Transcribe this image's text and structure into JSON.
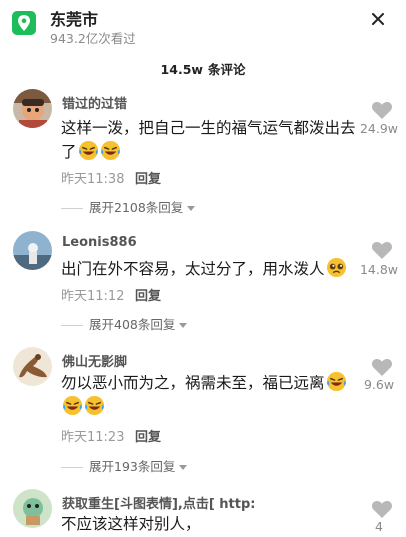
{
  "header": {
    "location_name": "东莞市",
    "views": "943.2亿次看过",
    "location_icon": "location-pin-icon",
    "close_icon": "close-icon"
  },
  "comment_count": {
    "number": "14.5w",
    "label": "条评论"
  },
  "comments": [
    {
      "username": "错过的过错",
      "text": "这样一泼，把自己一生的福气运气都泼出去了",
      "emoji": [
        "laughing-crying-emoji",
        "laughing-crying-emoji"
      ],
      "time": "昨天11:38",
      "reply": "回复",
      "expand": "展开2108条回复",
      "likes": "24.9w"
    },
    {
      "username": "Leonis886",
      "text": "出门在外不容易，太过分了，用水泼人",
      "emoji": [
        "pleading-face-emoji"
      ],
      "time": "昨天11:12",
      "reply": "回复",
      "expand": "展开408条回复",
      "likes": "14.8w"
    },
    {
      "username": "佛山无影脚",
      "text": "勿以恶小而为之，祸需未至，福已远离",
      "emoji": [
        "laughing-crying-emoji",
        "laughing-crying-emoji",
        "laughing-crying-emoji"
      ],
      "time": "昨天11:23",
      "reply": "回复",
      "expand": "展开193条回复",
      "likes": "9.6w"
    },
    {
      "username": "获取重生[斗图表情],点击[ http:",
      "text": "不应该这样对别人，",
      "likes": "4"
    }
  ],
  "colors": {
    "accent_green": "#1fbd5a",
    "emoji_yellow": "#f7c02e",
    "tear_blue": "#3aa3f0"
  }
}
